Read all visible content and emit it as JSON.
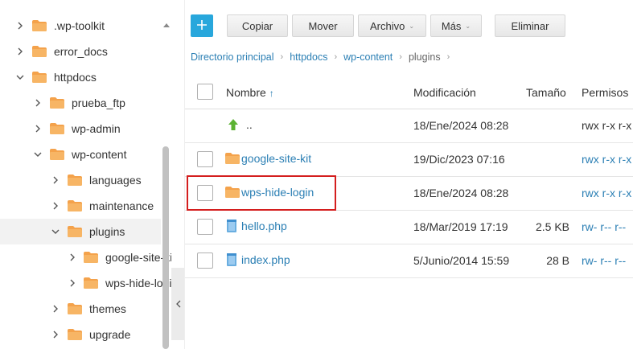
{
  "toolbar": {
    "add_label": "+",
    "buttons": [
      {
        "label": "Copiar"
      },
      {
        "label": "Mover"
      },
      {
        "label": "Archivo"
      },
      {
        "label": "Más"
      },
      {
        "label": "Eliminar"
      }
    ]
  },
  "breadcrumb": [
    "Directorio principal",
    "httpdocs",
    "wp-content",
    "plugins"
  ],
  "tree": [
    {
      "label": ".wp-toolkit",
      "expanded": false,
      "depth": 0
    },
    {
      "label": "error_docs",
      "expanded": false,
      "depth": 0
    },
    {
      "label": "httpdocs",
      "expanded": true,
      "depth": 0
    },
    {
      "label": "prueba_ftp",
      "expanded": false,
      "depth": 1
    },
    {
      "label": "wp-admin",
      "expanded": false,
      "depth": 1
    },
    {
      "label": "wp-content",
      "expanded": true,
      "depth": 1
    },
    {
      "label": "languages",
      "expanded": false,
      "depth": 2
    },
    {
      "label": "maintenance",
      "expanded": false,
      "depth": 2
    },
    {
      "label": "plugins",
      "expanded": true,
      "depth": 2,
      "selected": true
    },
    {
      "label": "google-site-kit",
      "expanded": false,
      "depth": 3
    },
    {
      "label": "wps-hide-login",
      "expanded": false,
      "depth": 3
    },
    {
      "label": "themes",
      "expanded": false,
      "depth": 2
    },
    {
      "label": "upgrade",
      "expanded": false,
      "depth": 2
    }
  ],
  "table": {
    "headers": {
      "name": "Nombre",
      "sort_arrow": "↑",
      "modified": "Modificación",
      "size": "Tamaño",
      "perms": "Permisos"
    },
    "rows": [
      {
        "type": "parent",
        "name": "..",
        "modified": "18/Ene/2024 08:28",
        "size": "",
        "perms": "rwx r-x r-x"
      },
      {
        "type": "folder",
        "name": "google-site-kit",
        "modified": "19/Dic/2023 07:16",
        "size": "",
        "perms": "rwx r-x r-x"
      },
      {
        "type": "folder",
        "name": "wps-hide-login",
        "modified": "18/Ene/2024 08:28",
        "size": "",
        "perms": "rwx r-x r-x",
        "highlighted": true
      },
      {
        "type": "file",
        "name": "hello.php",
        "modified": "18/Mar/2019 17:19",
        "size": "2.5 KB",
        "perms": "rw- r-- r--"
      },
      {
        "type": "file",
        "name": "index.php",
        "modified": "5/Junio/2014 15:59",
        "size": "28 B",
        "perms": "rw- r-- r--"
      }
    ]
  },
  "colors": {
    "accent": "#28a7dc",
    "link": "#2b7fb4",
    "folder": "#f4a24b",
    "highlight": "#d41e1e"
  }
}
